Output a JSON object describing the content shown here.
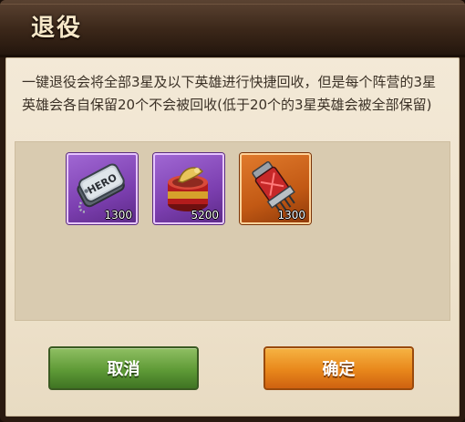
{
  "dialog": {
    "title": "退役",
    "description": "一键退役会将全部3星及以下英雄进行快捷回收，但是每个阵营的3星英雄会各自保留20个不会被回收(低于20个的3星英雄会被全部保留)"
  },
  "rewards": [
    {
      "icon": "hero-dog-tag-icon",
      "rarity": "purple",
      "count": "1300"
    },
    {
      "icon": "canned-food-icon",
      "rarity": "purple",
      "count": "5200"
    },
    {
      "icon": "energy-capsule-icon",
      "rarity": "orange",
      "count": "1300"
    }
  ],
  "buttons": {
    "cancel_label": "取消",
    "confirm_label": "确定"
  },
  "colors": {
    "header": "#3b2719",
    "body_bg": "#efe3cd",
    "reward_panel": "#d9cbb0",
    "purple_frame": "#8a4cc2",
    "orange_frame": "#d06a1c",
    "cancel_button": "#5e9a36",
    "confirm_button": "#e8871b"
  }
}
